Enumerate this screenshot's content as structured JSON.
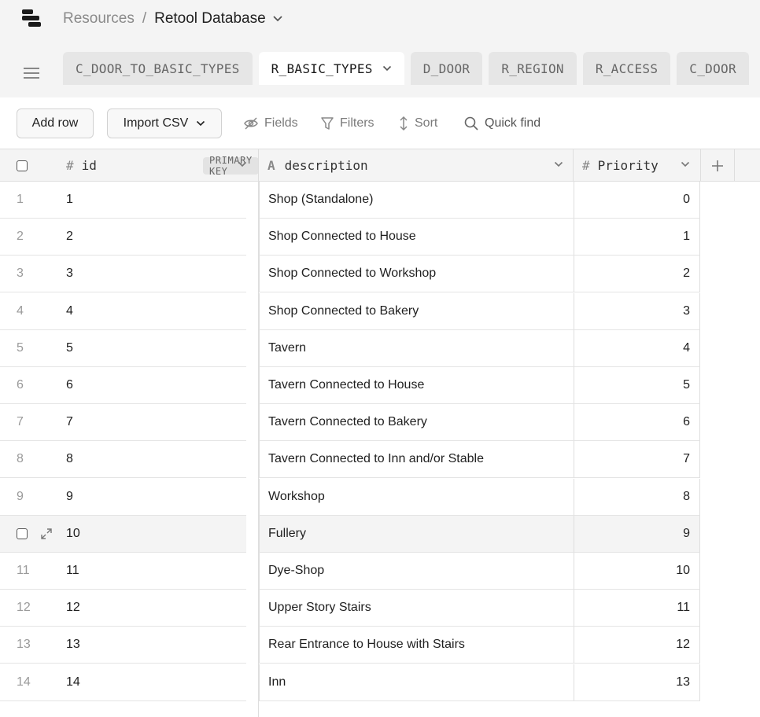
{
  "breadcrumb": {
    "parent": "Resources",
    "separator": "/",
    "current": "Retool Database"
  },
  "tabs": [
    {
      "label": "C_DOOR_TO_BASIC_TYPES",
      "active": false
    },
    {
      "label": "R_BASIC_TYPES",
      "active": true
    },
    {
      "label": "D_DOOR",
      "active": false
    },
    {
      "label": "R_REGION",
      "active": false
    },
    {
      "label": "R_ACCESS",
      "active": false
    },
    {
      "label": "C_DOOR",
      "active": false
    }
  ],
  "toolbar": {
    "add_row": "Add row",
    "import_csv": "Import CSV",
    "fields": "Fields",
    "filters": "Filters",
    "sort": "Sort",
    "quick_find": "Quick find"
  },
  "columns": {
    "id": {
      "type_icon": "#",
      "label": "id",
      "badge": "PRIMARY KEY"
    },
    "description": {
      "type_icon": "A",
      "label": "description"
    },
    "priority": {
      "type_icon": "#",
      "label": "Priority"
    }
  },
  "rows": [
    {
      "num": "1",
      "id": "1",
      "description": "Shop (Standalone)",
      "priority": "0"
    },
    {
      "num": "2",
      "id": "2",
      "description": "Shop Connected to House",
      "priority": "1"
    },
    {
      "num": "3",
      "id": "3",
      "description": "Shop Connected to Workshop",
      "priority": "2"
    },
    {
      "num": "4",
      "id": "4",
      "description": "Shop Connected to Bakery",
      "priority": "3"
    },
    {
      "num": "5",
      "id": "5",
      "description": "Tavern",
      "priority": "4"
    },
    {
      "num": "6",
      "id": "6",
      "description": "Tavern Connected to House",
      "priority": "5"
    },
    {
      "num": "7",
      "id": "7",
      "description": "Tavern Connected to Bakery",
      "priority": "6"
    },
    {
      "num": "8",
      "id": "8",
      "description": "Tavern Connected to Inn and/or Stable",
      "priority": "7"
    },
    {
      "num": "9",
      "id": "9",
      "description": "Workshop",
      "priority": "8"
    },
    {
      "num": "10",
      "id": "10",
      "description": "Fullery",
      "priority": "9",
      "hovered": true
    },
    {
      "num": "11",
      "id": "11",
      "description": "Dye-Shop",
      "priority": "10"
    },
    {
      "num": "12",
      "id": "12",
      "description": "Upper Story Stairs",
      "priority": "11"
    },
    {
      "num": "13",
      "id": "13",
      "description": "Rear Entrance to House with Stairs",
      "priority": "12"
    },
    {
      "num": "14",
      "id": "14",
      "description": "Inn",
      "priority": "13"
    }
  ]
}
